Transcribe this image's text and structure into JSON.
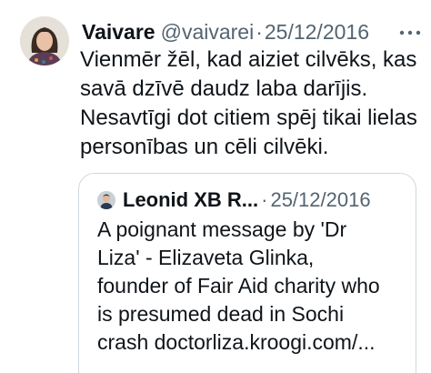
{
  "tweet": {
    "author": {
      "display_name": "Vaivare",
      "handle": "@vaivarei",
      "avatar_icon": "profile-photo-woman"
    },
    "separator": "·",
    "date": "25/12/2016",
    "more_icon": "more-horizontal-icon",
    "text_lines": [
      "Vienmēr žēl, kad aiziet cilvēks, kas",
      "savā dzīvē daudz laba darījis.",
      "Nesavtīgi dot citiem spēj tikai lielas",
      "personības un cēli cilvēki."
    ]
  },
  "quoted_tweet": {
    "author": {
      "display_name": "Leonid XB R...",
      "avatar_icon": "profile-photo-man"
    },
    "separator": "·",
    "date": "25/12/2016",
    "text_lines": [
      "A poignant message by 'Dr",
      "Liza' - Elizaveta Glinka,",
      "founder of Fair Aid charity who",
      "is presumed dead in Sochi",
      "crash doctorliza.kroogi.com/..."
    ]
  },
  "colors": {
    "primary_text": "#0f1419",
    "secondary_text": "#536471",
    "border": "#cfd9de",
    "background": "#ffffff"
  }
}
